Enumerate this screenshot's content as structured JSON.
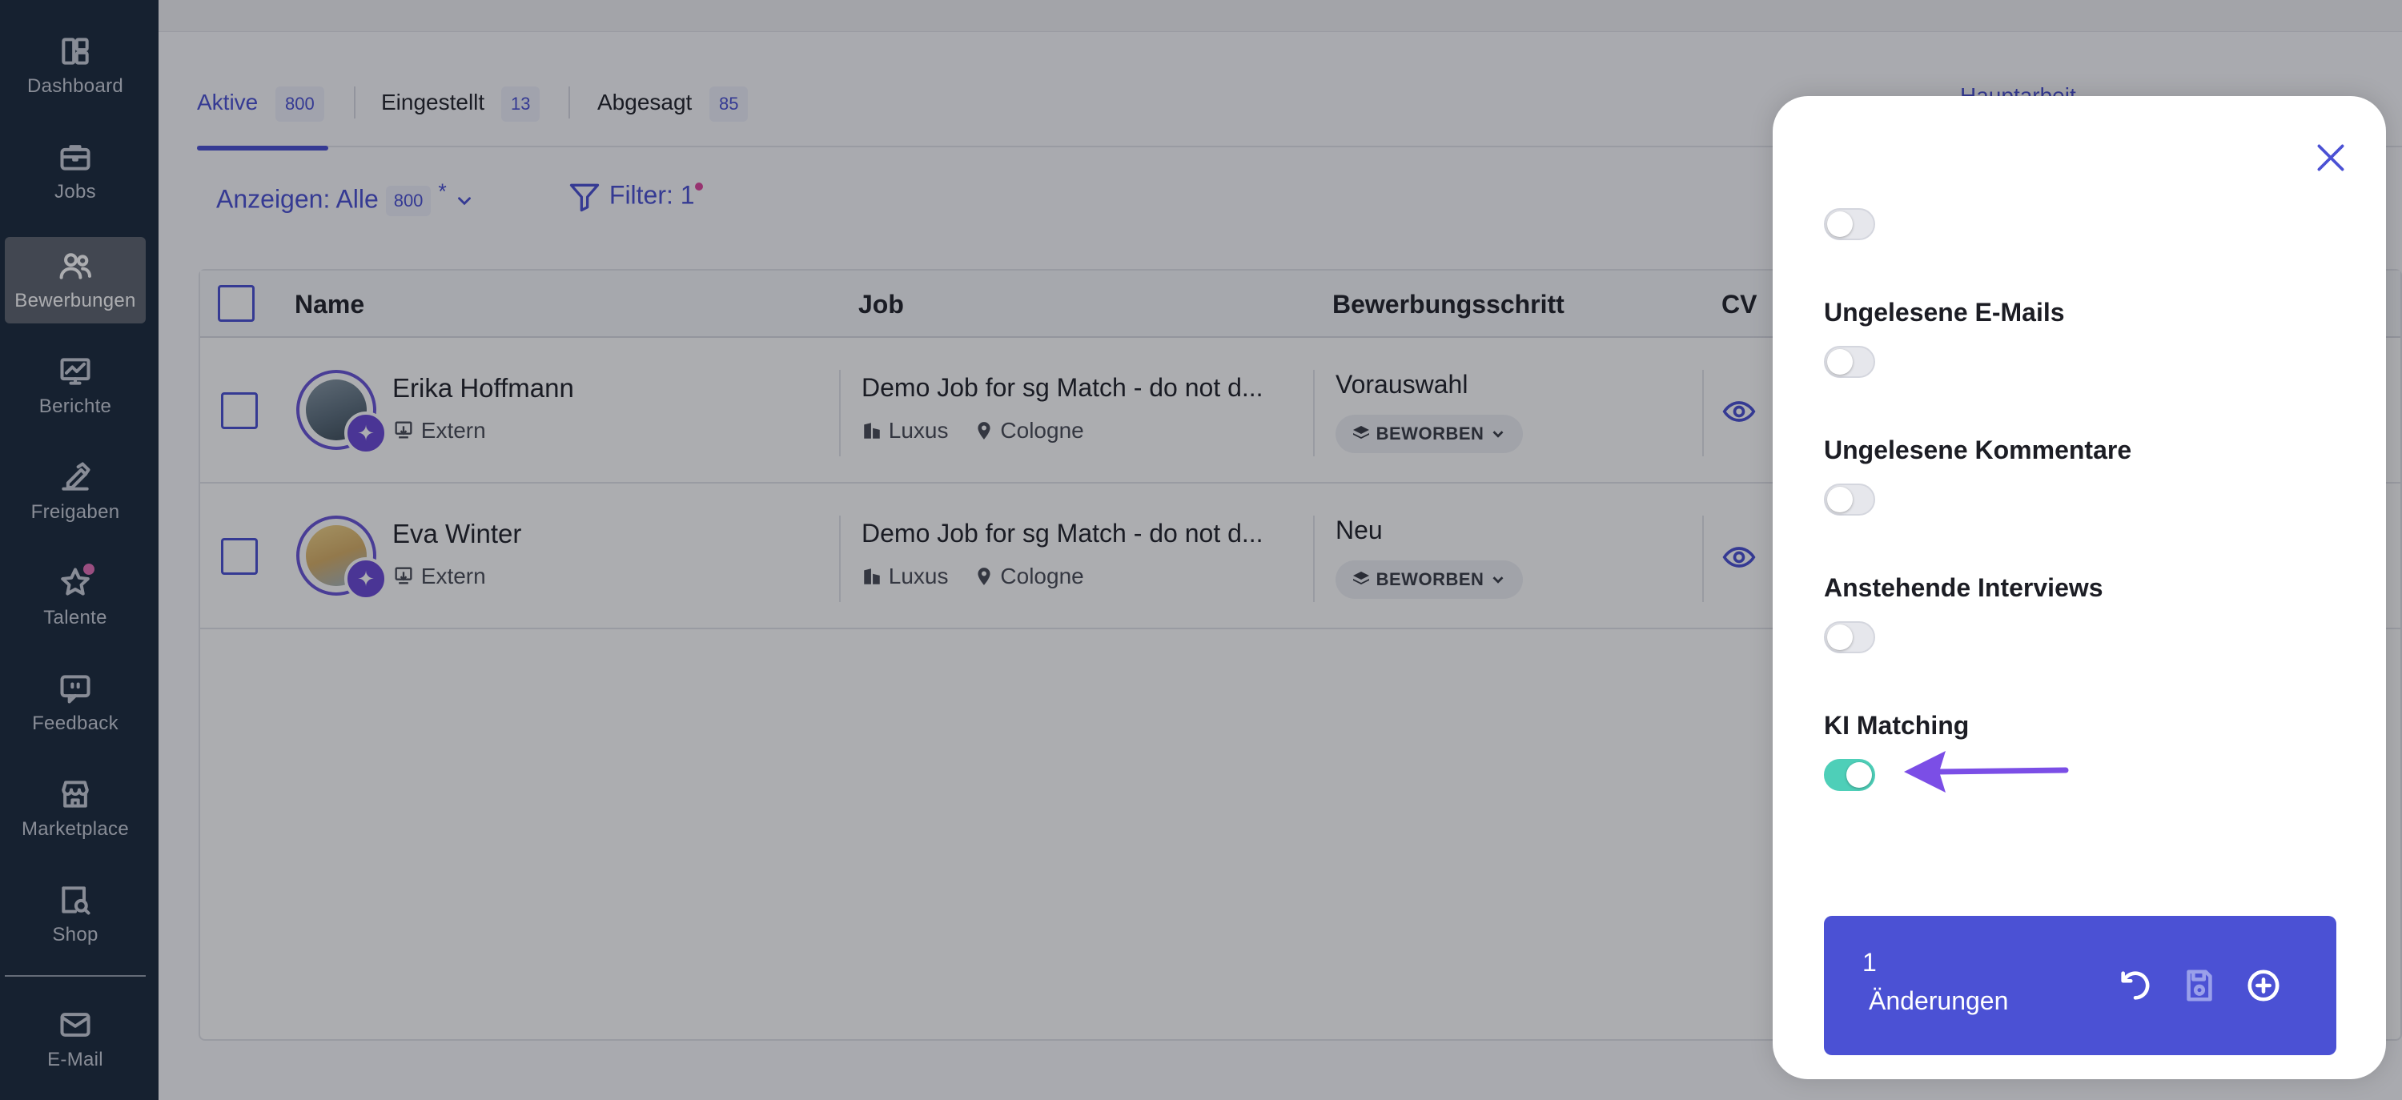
{
  "sidebar": {
    "items": [
      {
        "label": "Dashboard",
        "icon": "dashboard-icon"
      },
      {
        "label": "Jobs",
        "icon": "briefcase-icon"
      },
      {
        "label": "Bewerbungen",
        "icon": "users-icon",
        "active": true
      },
      {
        "label": "Berichte",
        "icon": "chart-icon"
      },
      {
        "label": "Freigaben",
        "icon": "approval-icon"
      },
      {
        "label": "Talente",
        "icon": "star-icon"
      },
      {
        "label": "Feedback",
        "icon": "feedback-icon"
      },
      {
        "label": "Marketplace",
        "icon": "store-icon"
      },
      {
        "label": "Shop",
        "icon": "shop-search-icon"
      },
      {
        "label": "E-Mail",
        "icon": "mail-icon"
      }
    ]
  },
  "tabs": [
    {
      "label": "Aktive",
      "count": "800",
      "active": true
    },
    {
      "label": "Eingestellt",
      "count": "13"
    },
    {
      "label": "Abgesagt",
      "count": "85"
    }
  ],
  "toolbar": {
    "right_text": "Hauptarbeit"
  },
  "showbar": {
    "label": "Anzeigen:",
    "value": "Alle",
    "count": "800",
    "mark": "*"
  },
  "filter": {
    "label": "Filter: 1"
  },
  "table": {
    "headers": {
      "name": "Name",
      "job": "Job",
      "step": "Bewerbungsschritt",
      "cv": "CV"
    },
    "rows": [
      {
        "name": "Erika Hoffmann",
        "source": "Extern",
        "job": "Demo Job for sg Match - do not d...",
        "company": "Luxus",
        "location": "Cologne",
        "step": "Vorauswahl",
        "stage": "BEWORBEN"
      },
      {
        "name": "Eva Winter",
        "source": "Extern",
        "job": "Demo Job for sg Match - do not d...",
        "company": "Luxus",
        "location": "Cologne",
        "step": "Neu",
        "stage": "BEWORBEN"
      }
    ]
  },
  "drawer": {
    "options": [
      {
        "label": "",
        "on": false
      },
      {
        "label": "Ungelesene E-Mails",
        "on": false
      },
      {
        "label": "Ungelesene Kommentare",
        "on": false
      },
      {
        "label": "Anstehende Interviews",
        "on": false
      },
      {
        "label": "KI Matching",
        "on": true
      }
    ],
    "changes": {
      "count": "1",
      "label": "Änderungen"
    }
  },
  "colors": {
    "accent": "#4b51d4",
    "sidebar": "#1c2b3e",
    "toggle_on": "#4ecfb8",
    "arrow": "#7b4ee6"
  }
}
